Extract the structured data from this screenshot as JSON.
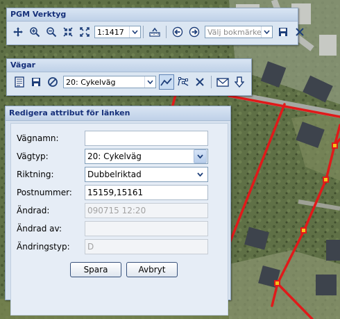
{
  "map": {
    "road_color": "#e01a1a",
    "node_color": "#f7c218"
  },
  "toolbar_verktyg": {
    "title": "PGM Verktyg",
    "scale_value": "1:1417",
    "bookmark_placeholder": "Välj bokmärke",
    "icons": [
      "pan-icon",
      "zoom-in-icon",
      "zoom-out-icon",
      "zoom-extent-in-icon",
      "zoom-extent-out-icon",
      "scale-dropdown",
      "measure-icon",
      "back-icon",
      "forward-icon",
      "bookmark-dropdown",
      "save-icon",
      "close-icon"
    ]
  },
  "toolbar_vagar": {
    "title": "Vägar",
    "road_type_value": "20: Cykelväg",
    "icons": [
      "edit-icon",
      "save-icon",
      "cancel-icon",
      "road-type-dropdown",
      "draw-line-icon",
      "edit-vertices-icon",
      "delete-icon",
      "mail-icon",
      "download-icon"
    ]
  },
  "edit_dialog": {
    "title": "Redigera attribut för länken",
    "fields": {
      "vagnamn": {
        "label": "Vägnamn:",
        "value": ""
      },
      "vagtyp": {
        "label": "Vägtyp:",
        "value": "20: Cykelväg"
      },
      "riktning": {
        "label": "Riktning:",
        "value": "Dubbelriktad"
      },
      "postnummer": {
        "label": "Postnummer:",
        "value": "15159,15161"
      },
      "andrad": {
        "label": "Ändrad:",
        "value": "090715 12:20"
      },
      "andrad_av": {
        "label": "Ändrad av:",
        "value": ""
      },
      "andringstyp": {
        "label": "Ändringstyp:",
        "value": "D"
      }
    },
    "save_label": "Spara",
    "cancel_label": "Avbryt"
  }
}
